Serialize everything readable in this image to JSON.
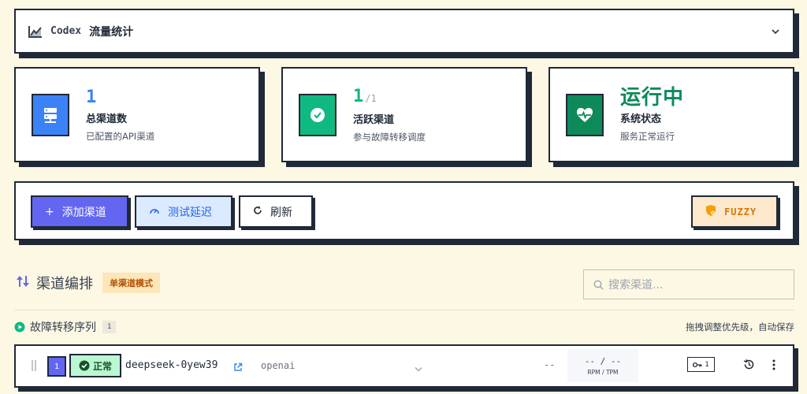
{
  "header": {
    "app_name": "Codex",
    "title": "流量统计",
    "chart_icon": "chart-line-icon",
    "chevron_icon": "chevron-down-icon"
  },
  "stats": [
    {
      "value": "1",
      "total": "",
      "label": "总渠道数",
      "sub": "已配置的API渠道",
      "icon": "server-icon",
      "color": "#3b82f6",
      "value_color": "#3b82f6"
    },
    {
      "value": "1",
      "total": "/1",
      "label": "活跃渠道",
      "sub": "参与故障转移调度",
      "icon": "check-circle-icon",
      "color": "#10b981",
      "value_color": "#10b981"
    },
    {
      "value": "运行中",
      "total": "",
      "label": "系统状态",
      "sub": "服务正常运行",
      "icon": "heart-pulse-icon",
      "color": "#0e8a5a",
      "value_color": "#0e8a5a"
    }
  ],
  "toolbar": {
    "add_label": "添加渠道",
    "test_label": "测试延迟",
    "refresh_label": "刷新",
    "fuzzy_label": "FUZZY",
    "colors": {
      "add": "#6366f1",
      "test": "#dbeafe",
      "fuzzy": "#fde8cc"
    }
  },
  "section": {
    "title": "渠道编排",
    "mode_badge": "单渠道模式",
    "search_placeholder": "搜索渠道...",
    "queue_title": "故障转移序列",
    "queue_count": "1",
    "hint": "拖拽调整优先级，自动保存"
  },
  "channels": [
    {
      "priority": "1",
      "status": "正常",
      "name": "deepseek-0yew39",
      "provider": "openai",
      "latency": "--",
      "rate": "-- / --",
      "rate_label": "RPM / TPM",
      "key_count": "1"
    }
  ]
}
